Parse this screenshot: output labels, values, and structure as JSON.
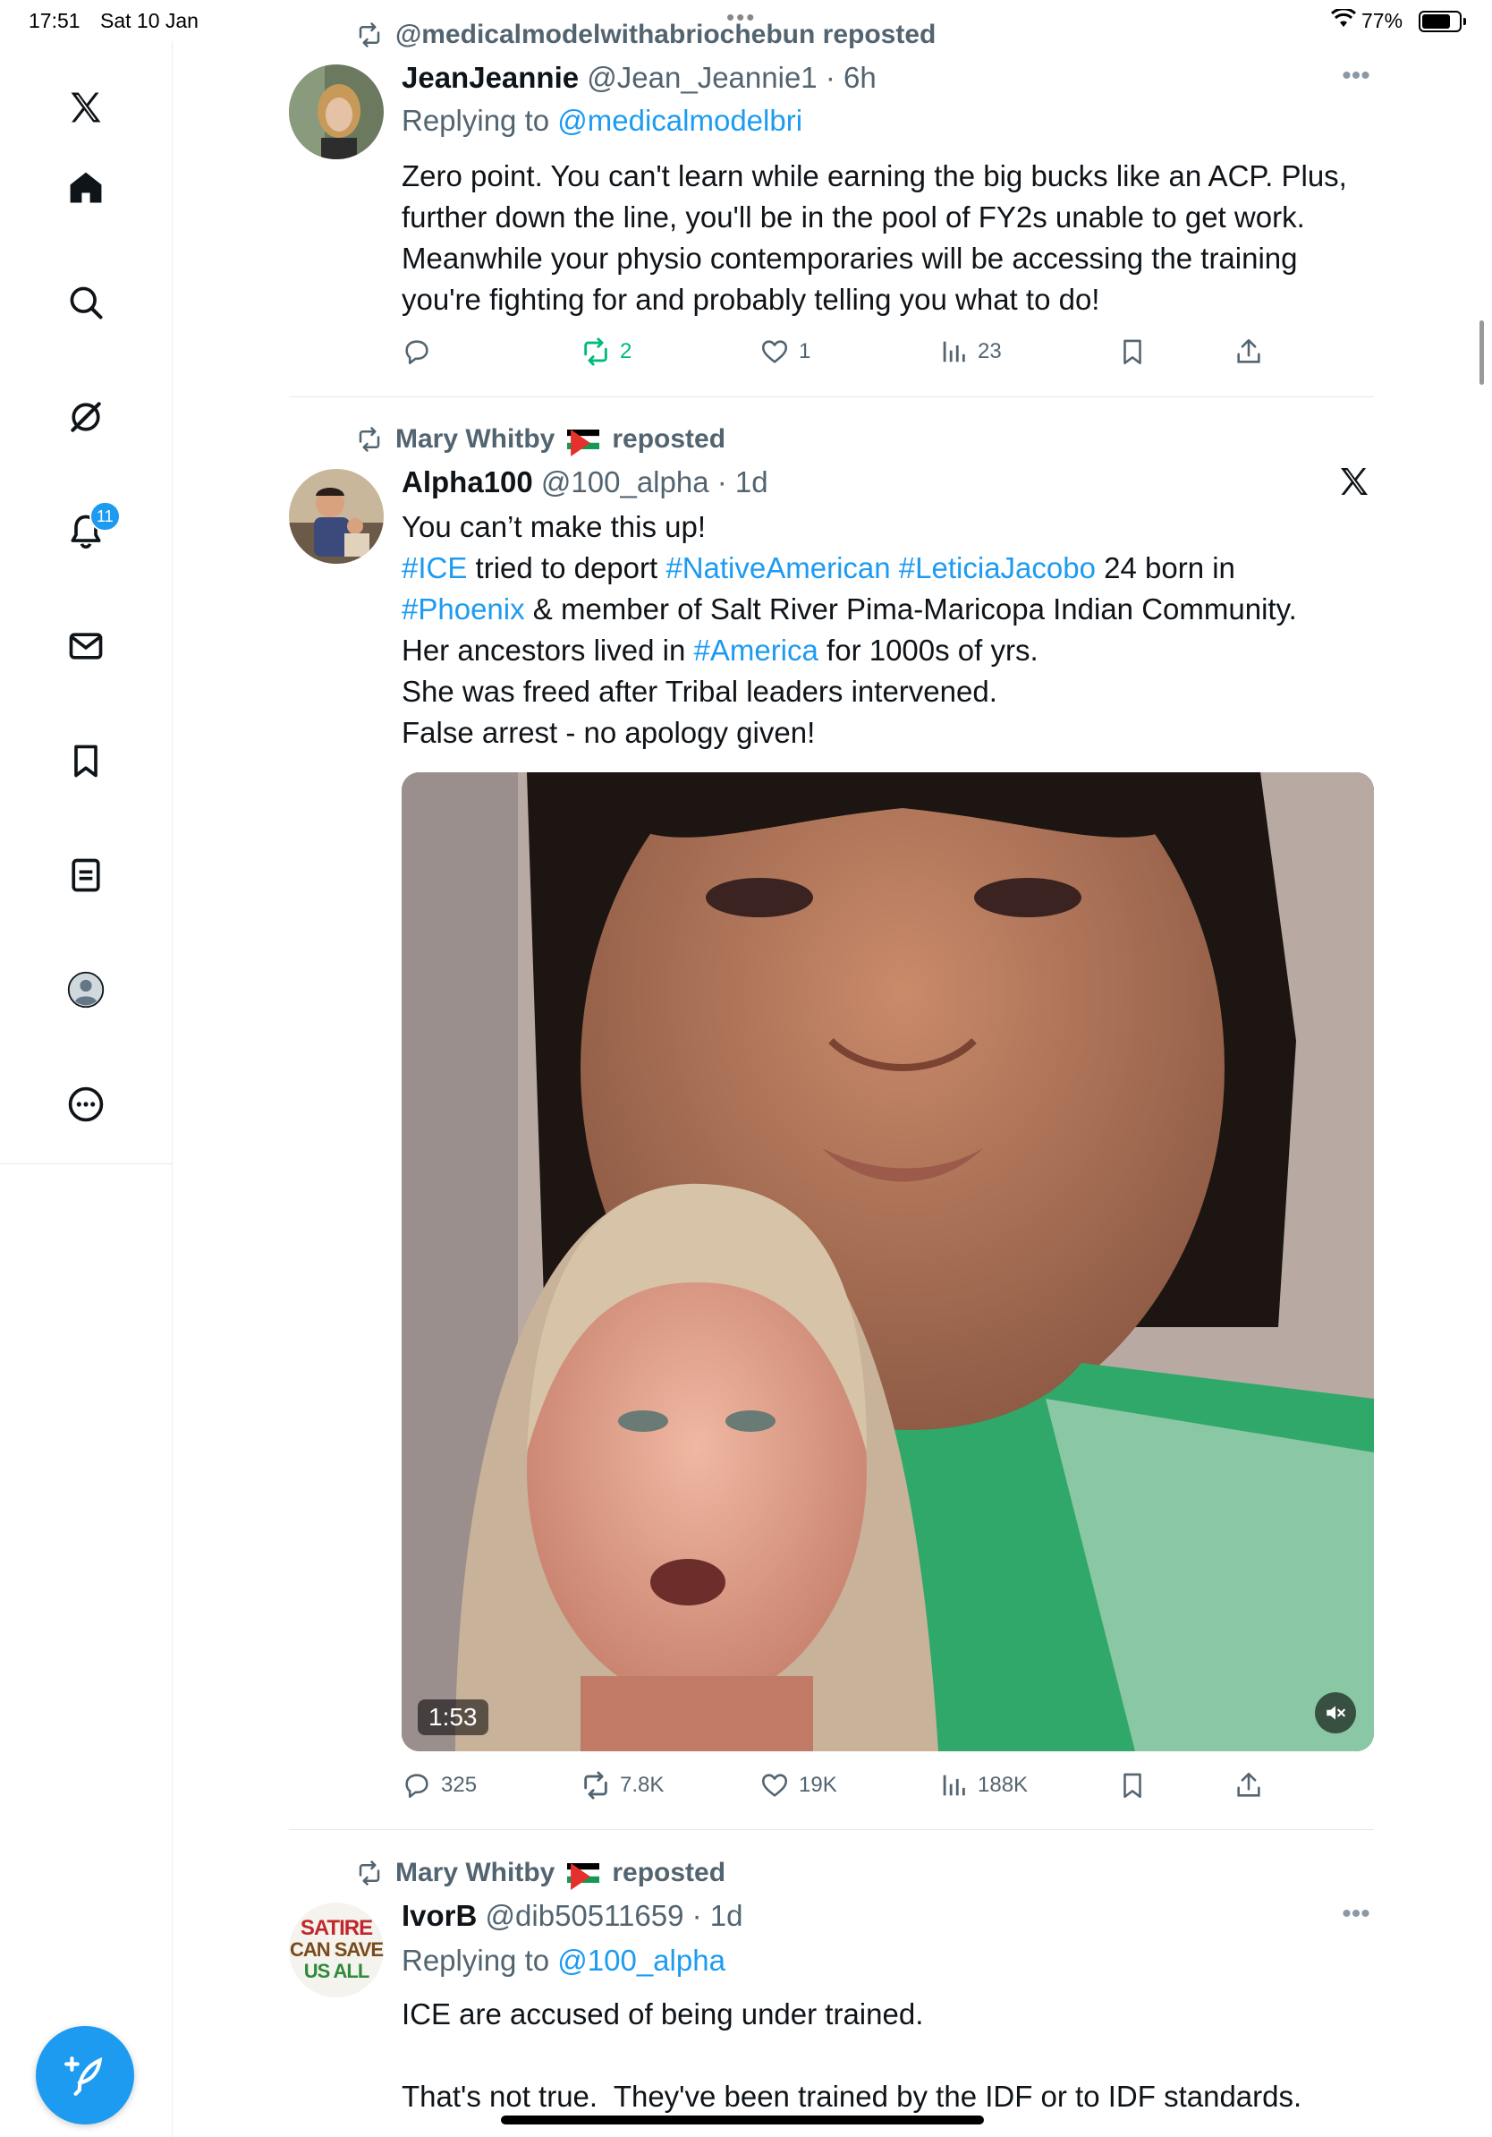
{
  "status_bar": {
    "time": "17:51",
    "date": "Sat 10 Jan",
    "battery": "77%",
    "battery_level": 0.77
  },
  "sidebar": {
    "logo": "x-logo-icon",
    "items": [
      {
        "name": "home",
        "icon": "home-icon"
      },
      {
        "name": "explore",
        "icon": "search-icon"
      },
      {
        "name": "grok",
        "icon": "grok-icon"
      },
      {
        "name": "notifications",
        "icon": "bell-icon",
        "badge": "11"
      },
      {
        "name": "messages",
        "icon": "mail-icon"
      },
      {
        "name": "bookmarks",
        "icon": "bookmark-icon"
      },
      {
        "name": "lists",
        "icon": "list-icon"
      },
      {
        "name": "profile",
        "icon": "avatar-icon"
      },
      {
        "name": "more",
        "icon": "more-circle-icon"
      }
    ],
    "compose": "compose-icon"
  },
  "tweets": [
    {
      "reposted_by": "@medicalmodelwithabriochebun reposted",
      "name": "JeanJeannie",
      "handle": "@Jean_Jeannie1",
      "time": "6h",
      "replying_prefix": "Replying to ",
      "replying_to": "@medicalmodelbri",
      "text": "Zero point. You can't learn while earning the big bucks like an ACP. Plus, further down the line, you'll be in the pool of FY2s unable to get work. Meanwhile your physio contemporaries will be accessing the training you're fighting for and probably telling you what to do!",
      "replies": "",
      "retweets": "2",
      "likes": "1",
      "views": "23"
    },
    {
      "reposted_by": "Mary Whitby",
      "reposted_suffix": "reposted",
      "name": "Alpha100",
      "handle": "@100_alpha",
      "time": "1d",
      "text_parts": [
        {
          "t": "You can’t make this up!\n"
        },
        {
          "t": "#ICE",
          "link": true
        },
        {
          "t": " tried to deport "
        },
        {
          "t": "#NativeAmerican",
          "link": true
        },
        {
          "t": " "
        },
        {
          "t": "#LeticiaJacobo",
          "link": true
        },
        {
          "t": " 24 born in\n"
        },
        {
          "t": "#Phoenix",
          "link": true
        },
        {
          "t": " & member of Salt River Pima-Maricopa Indian Community.\nHer ancestors lived in "
        },
        {
          "t": "#America",
          "link": true
        },
        {
          "t": " for 1000s of yrs.\nShe was freed after Tribal leaders intervened.\nFalse arrest - no apology given!"
        }
      ],
      "video_duration": "1:53",
      "replies": "325",
      "retweets": "7.8K",
      "likes": "19K",
      "views": "188K"
    },
    {
      "reposted_by": "Mary Whitby",
      "reposted_suffix": "reposted",
      "name": "IvorB",
      "handle": "@dib50511659",
      "time": "1d",
      "replying_prefix": "Replying to ",
      "replying_to": "@100_alpha",
      "avatar_text": [
        "SATIRE",
        "CAN SAVE",
        "US ALL"
      ],
      "text": "ICE are accused of being under trained.\n\nThat's not true.  They've been trained by the IDF or to IDF standards."
    }
  ],
  "colors": {
    "accent": "#1d9bf0",
    "retweet_green": "#00ba7c",
    "muted": "#536471"
  }
}
